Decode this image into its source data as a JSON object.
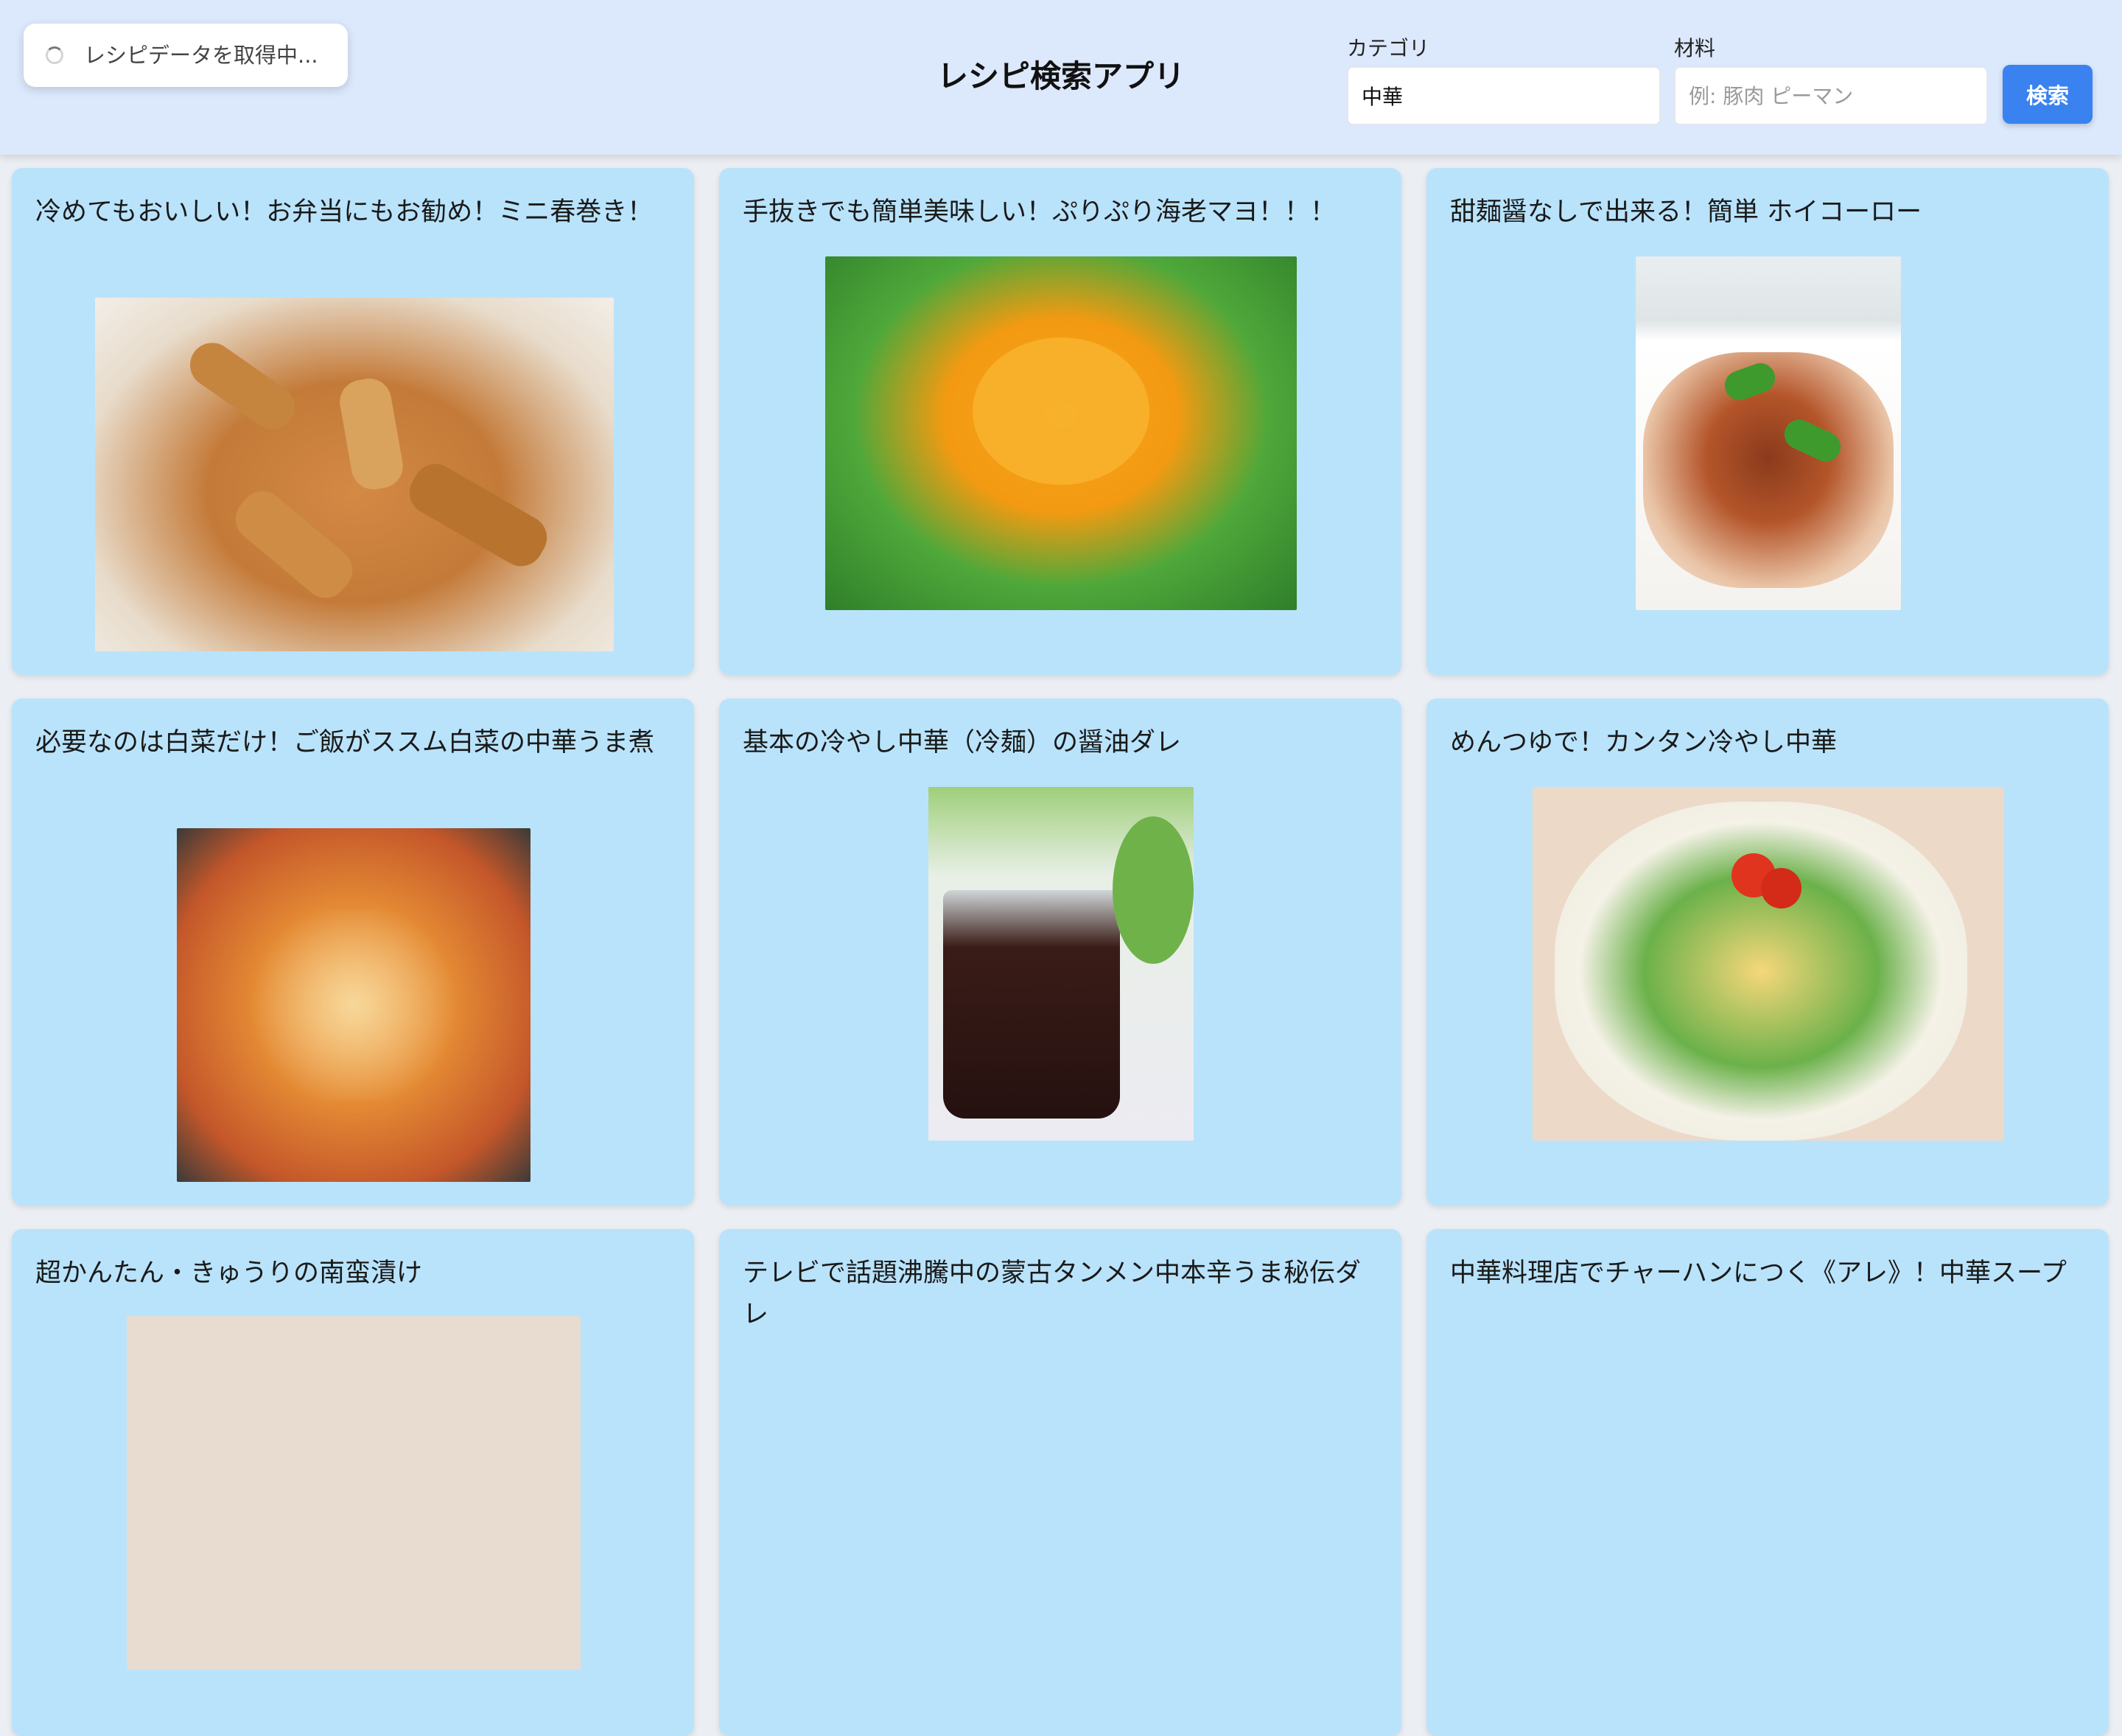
{
  "toast": {
    "text": "レシピデータを取得中..."
  },
  "header": {
    "title": "レシピ検索アプリ"
  },
  "search": {
    "category_label": "カテゴリ",
    "category_value": "中華",
    "ingredient_label": "材料",
    "ingredient_placeholder": "例: 豚肉 ピーマン",
    "button_label": "検索"
  },
  "recipes": [
    {
      "title": "冷めてもおいしい！お弁当にもお勧め！ミニ春巻き！",
      "image": "spring-rolls"
    },
    {
      "title": "手抜きでも簡単美味しい！ぷりぷり海老マヨ！！！",
      "image": "shrimp-mayo"
    },
    {
      "title": "甜麺醤なしで出来る！簡単 ホイコーロー",
      "image": "hoikoro"
    },
    {
      "title": "必要なのは白菜だけ！ご飯がススム白菜の中華うま煮",
      "image": "napa-cabbage-stew"
    },
    {
      "title": "基本の冷やし中華（冷麺）の醤油ダレ",
      "image": "soy-sauce-dressing"
    },
    {
      "title": "めんつゆで！カンタン冷やし中華",
      "image": "hiyashi-chuka"
    },
    {
      "title": "超かんたん・きゅうりの南蛮漬け",
      "image": "cucumber-nanban"
    },
    {
      "title": "テレビで話題沸騰中の蒙古タンメン中本辛うま秘伝ダレ",
      "image": "mouko-tanmen"
    },
    {
      "title": "中華料理店でチャーハンにつく《アレ》！中華スープ",
      "image": "chinese-soup"
    }
  ]
}
